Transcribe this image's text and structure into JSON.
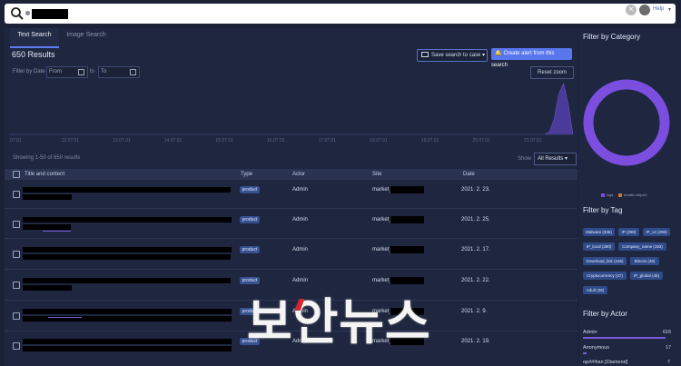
{
  "search": {
    "query": "",
    "help": "Help"
  },
  "tabs": [
    {
      "label": "Text Search"
    },
    {
      "label": "Image Search"
    }
  ],
  "results": {
    "title": "650 Results",
    "save_button": "Save search to case",
    "alert_button": "Create alert from this search",
    "filter_label": "Filter by Date",
    "from_placeholder": "From",
    "to_label": "to",
    "to_placeholder": "To",
    "reset_zoom": "Reset zoom",
    "showing": "Showing 1-50 of 650 results",
    "show_label": "Show",
    "show_value": "All Results"
  },
  "chart_data": {
    "type": "area",
    "x_ticks": [
      "07.01",
      "12.07.01",
      "13.07.01",
      "14.07.01",
      "15.07.01",
      "16.07.01",
      "17.07.01",
      "18.07.01",
      "19.07.01",
      "20.07.01",
      "21.07.01"
    ],
    "values": [
      0,
      0,
      0,
      0,
      0,
      0,
      0,
      0,
      0,
      0,
      0,
      0,
      0,
      0,
      0,
      0,
      0,
      0,
      0,
      0,
      0,
      0,
      0,
      0,
      0,
      0,
      0,
      0,
      0,
      0,
      0,
      0,
      0,
      0,
      0,
      0,
      0,
      0,
      0,
      0,
      0,
      0,
      0,
      0,
      0,
      0,
      0,
      0,
      0,
      0,
      0,
      0,
      0,
      0,
      0,
      0,
      0,
      0,
      0,
      0,
      0,
      0,
      0,
      0,
      0,
      0,
      0,
      0,
      0,
      0,
      0,
      0,
      0,
      0,
      0,
      0,
      0,
      0,
      0,
      0,
      0,
      0,
      0,
      0,
      0,
      0,
      0,
      0,
      0,
      0,
      0,
      0,
      0,
      0,
      0,
      0,
      0,
      0,
      0,
      0,
      0,
      0,
      0,
      0,
      0,
      0,
      0,
      0,
      0,
      0,
      0,
      0,
      0,
      0,
      0,
      5,
      30,
      80,
      100,
      60,
      0
    ],
    "series_color": "#4a3a9a",
    "grid": false
  },
  "table": {
    "columns": [
      "Title and content",
      "Type",
      "Actor",
      "Site",
      "Date"
    ],
    "rows": [
      {
        "type": "product",
        "actor": "Admin",
        "site": "market_",
        "date": "2021. 2. 23."
      },
      {
        "type": "product",
        "actor": "Admin",
        "site": "market_",
        "date": "2021. 2. 25."
      },
      {
        "type": "product",
        "actor": "Admin",
        "site": "market_",
        "date": "2021. 2. 17."
      },
      {
        "type": "product",
        "actor": "Admin",
        "site": "market_",
        "date": "2021. 2. 22."
      },
      {
        "type": "product",
        "actor": "Admin",
        "site": "market_",
        "date": "2021. 2. 9."
      },
      {
        "type": "product",
        "actor": "Admin",
        "site": "market_",
        "date": "2021. 2. 19."
      }
    ]
  },
  "category": {
    "title": "Filter by Category",
    "legend": [
      {
        "label": "logs",
        "color": "#7b4ee0"
      },
      {
        "label": "emails only:b2",
        "color": "#c9772a"
      }
    ],
    "donut_color": "#7b4ee0"
  },
  "tags": {
    "title": "Filter by Tag",
    "items": [
      "Malware (336)",
      "IP (290)",
      "IP_v4 (290)",
      "IP_local (280)",
      "Company_name (193)",
      "Download_link (155)",
      "Bitcoin (48)",
      "Cryptocurrency (47)",
      "IP_global (45)",
      "Adult (26)"
    ]
  },
  "actors": {
    "title": "Filter by Actor",
    "items": [
      {
        "name": "Admin",
        "count": "616",
        "fill": 0.95
      },
      {
        "name": "Anonymous",
        "count": "17",
        "fill": 0.04
      },
      {
        "name": "op###ian [Diamond]",
        "count": "7",
        "fill": 0.02
      }
    ]
  },
  "watermark": "보안뉴스"
}
